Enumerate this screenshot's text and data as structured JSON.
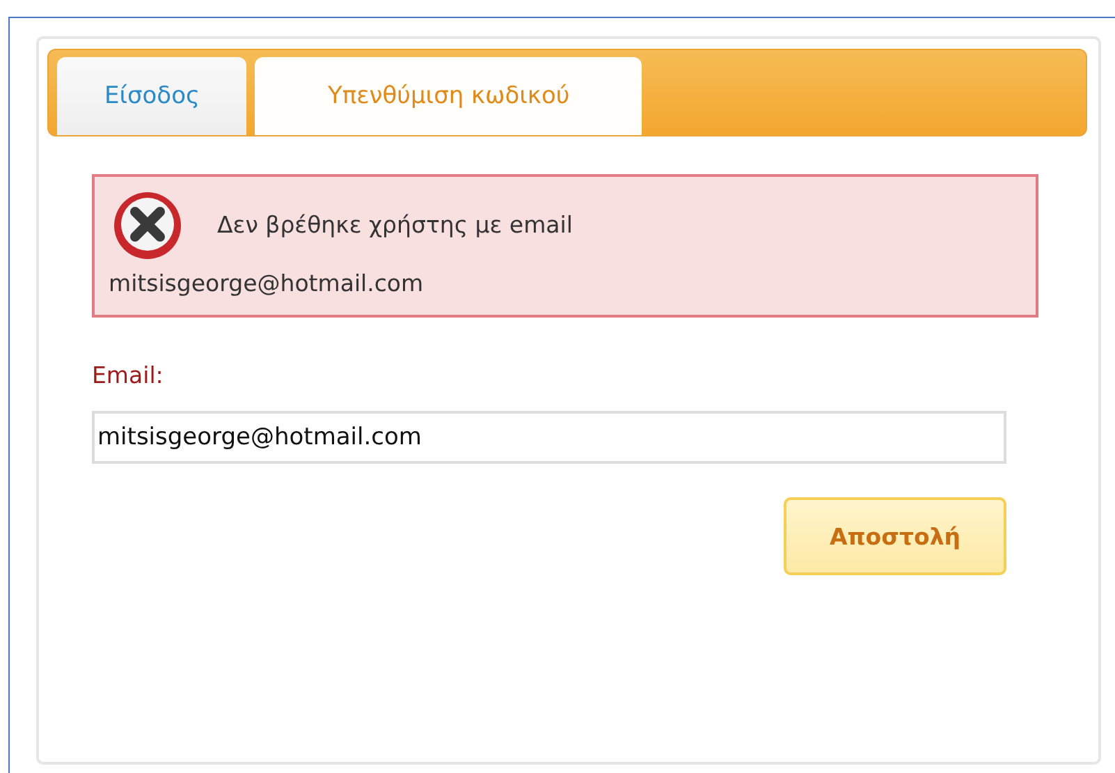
{
  "tabs": [
    {
      "label": "Είσοδος",
      "selected": false
    },
    {
      "label": "Υπενθύμιση κωδικού",
      "selected": true
    }
  ],
  "error": {
    "message": "Δεν βρέθηκε χρήστης με email",
    "email": "mitsisgeorge@hotmail.com"
  },
  "form": {
    "label": "Email:",
    "value": "mitsisgeorge@hotmail.com",
    "button": "Αποστολή"
  }
}
